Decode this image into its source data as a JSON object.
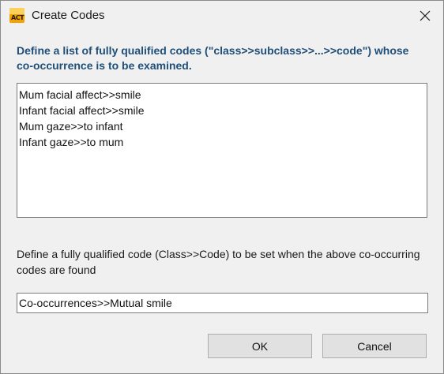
{
  "window": {
    "title": "Create Codes",
    "app_icon_text": "ACT",
    "close_icon": "close-icon"
  },
  "heading": "Define a list of fully qualified codes (\"class>>subclass>>...>>code\") whose co-occurrence is to be examined.",
  "codes": [
    "Mum facial affect>>smile",
    "Infant facial affect>>smile",
    "Mum gaze>>to infant",
    "Infant gaze>>to mum"
  ],
  "target": {
    "description": "Define a fully qualified code (Class>>Code) to be set when the above co-occurring codes are found",
    "value": "Co-occurrences>>Mutual smile"
  },
  "buttons": {
    "ok": "OK",
    "cancel": "Cancel"
  },
  "colors": {
    "heading": "#1f4e79",
    "background": "#f0f0f0",
    "app_icon": "#f5a100"
  }
}
